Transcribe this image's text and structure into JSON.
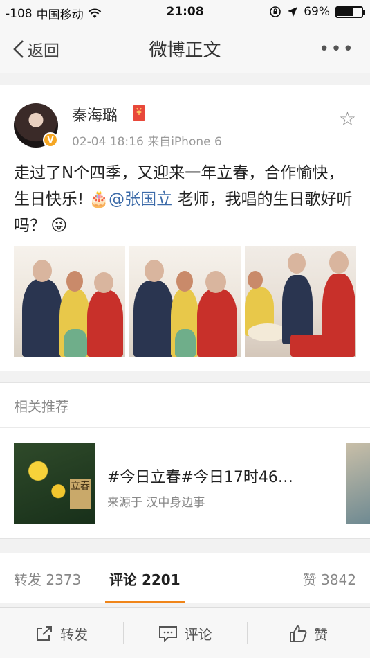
{
  "status_bar": {
    "signal": "-108",
    "carrier": "中国移动",
    "time": "21:08",
    "battery": "69%",
    "battery_level": 0.69
  },
  "nav": {
    "back_label": "返回",
    "title": "微博正文",
    "more_label": "•••"
  },
  "post": {
    "author": "秦海璐",
    "verified_badge": "V",
    "redpack_glyph": "¥",
    "timestamp": "02-04 18:16",
    "source": "来自iPhone 6",
    "text_part1": "走过了N个四季，又迎来一年立春，合作愉快，生日快乐! ",
    "cake_emoji": "🎂",
    "mention": "@张国立",
    "text_part2": " 老师，我唱的生日歌好听吗？ ",
    "face_emoji": "😜",
    "photos": [
      "photo-1",
      "photo-2",
      "photo-3"
    ]
  },
  "related": {
    "header": "相关推荐",
    "item_title": "#今日立春#今日17时46…",
    "item_source": "来源于 汉中身边事",
    "thumb_stamp": "立春"
  },
  "stats_tabs": {
    "repost": "转发 2373",
    "comment": "评论 2201",
    "like": "赞 3842"
  },
  "actions": {
    "repost": "转发",
    "comment": "评论",
    "like": "赞"
  },
  "colors": {
    "accent": "#f08519",
    "mention": "#3b6aa8",
    "badge": "#f5a623"
  }
}
